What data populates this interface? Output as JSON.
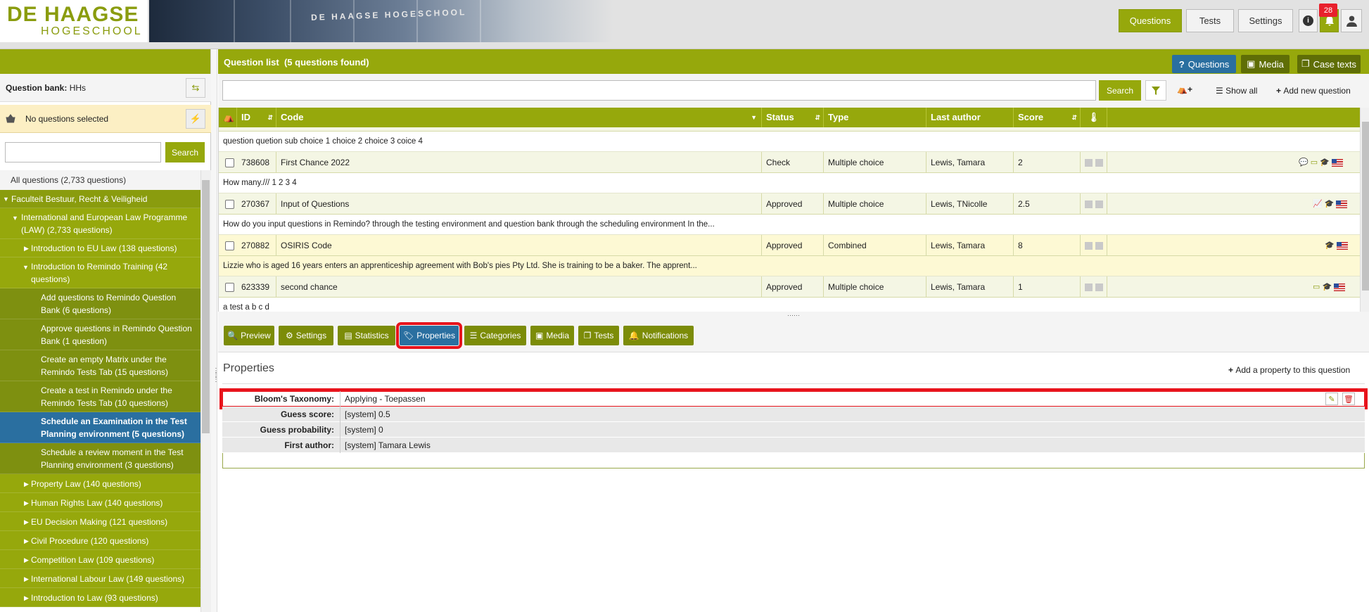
{
  "brand": {
    "line1": "DE HAAGSE",
    "line2": "HOGESCHOOL",
    "banner_text": "DE HAAGSE HOGESCHOOL"
  },
  "topnav": {
    "questions": "Questions",
    "tests": "Tests",
    "settings": "Settings",
    "info_icon": "i",
    "notification_count": "28"
  },
  "sidebar": {
    "bank_label": "Question bank:",
    "bank_value": "HHs",
    "no_selection": "No questions selected",
    "search_placeholder": "",
    "search_button": "Search",
    "tree": [
      {
        "label": "All questions (2,733 questions)"
      },
      {
        "label": "Faculteit Bestuur, Recht & Veiligheid"
      },
      {
        "label": "International and European Law Programme (LAW) (2,733 questions)"
      },
      {
        "label": "Introduction to EU Law (138 questions)"
      },
      {
        "label": "Introduction to Remindo Training (42 questions)"
      },
      {
        "label": "Add questions to Remindo Question Bank (6 questions)"
      },
      {
        "label": "Approve questions in Remindo Question Bank (1 question)"
      },
      {
        "label": "Create an empty Matrix under the Remindo Tests Tab (15 questions)"
      },
      {
        "label": "Create a test in Remindo under the Remindo Tests Tab (10 questions)"
      },
      {
        "label": "Schedule an Examination in the Test Planning environment (5 questions)"
      },
      {
        "label": "Schedule a review moment in the Test Planning environment (3 questions)"
      },
      {
        "label": "Property Law (140 questions)"
      },
      {
        "label": "Human Rights Law (140 questions)"
      },
      {
        "label": "EU Decision Making (121 questions)"
      },
      {
        "label": "Civil Procedure (120 questions)"
      },
      {
        "label": "Competition Law (109 questions)"
      },
      {
        "label": "International Labour Law (149 questions)"
      },
      {
        "label": "Introduction to Law (93 questions)"
      }
    ]
  },
  "main": {
    "list_title": "Question list",
    "list_count": "(5 questions found)",
    "btn_questions": "Questions",
    "btn_media": "Media",
    "btn_case_texts": "Case texts",
    "search_placeholder": "",
    "search_button": "Search",
    "show_all": "Show all",
    "add_new": "Add new question",
    "columns": {
      "id": "ID",
      "code": "Code",
      "status": "Status",
      "type": "Type",
      "last_author": "Last author",
      "score": "Score"
    },
    "rows": [
      {
        "desc": "question quetion sub choice 1 choice 2 choice 3 coice 4"
      },
      {
        "id": "738608",
        "code": "First Chance 2022",
        "status": "Check",
        "type": "Multiple choice",
        "author": "Lewis, Tamara",
        "score": "2",
        "desc": "How many./// 1 2 3 4"
      },
      {
        "id": "270367",
        "code": "Input of Questions",
        "status": "Approved",
        "type": "Multiple choice",
        "author": "Lewis, TNicolle",
        "score": "2.5",
        "desc": "How do you input questions in Remindo? through the testing environment and question bank through the scheduling environment In the..."
      },
      {
        "id": "270882",
        "code": "OSIRIS Code",
        "status": "Approved",
        "type": "Combined",
        "author": "Lewis, Tamara",
        "score": "8",
        "desc": "Lizzie who is aged 16 years enters an apprenticeship agreement with Bob's pies Pty Ltd. She is training to be a baker. The apprent..."
      },
      {
        "id": "623339",
        "code": "second chance",
        "status": "Approved",
        "type": "Multiple choice",
        "author": "Lewis, Tamara",
        "score": "1",
        "desc": "a test a b c d"
      }
    ],
    "tabs": [
      "Preview",
      "Settings",
      "Statistics",
      "Properties",
      "Categories",
      "Media",
      "Tests",
      "Notifications"
    ],
    "active_tab": "Properties"
  },
  "properties": {
    "title": "Properties",
    "add_label": "Add a property to this question",
    "rows": [
      {
        "key": "Bloom's Taxonomy:",
        "value": "Applying - Toepassen"
      },
      {
        "key": "Guess score:",
        "value": "[system] 0.5"
      },
      {
        "key": "Guess probability:",
        "value": "[system] 0"
      },
      {
        "key": "First author:",
        "value": "[system] Tamara Lewis"
      }
    ]
  },
  "colors": {
    "olive": "#96a80c",
    "active_blue": "#2a6fa0",
    "highlight_red": "#e8141c",
    "basket_yellow": "#fcefc4"
  }
}
